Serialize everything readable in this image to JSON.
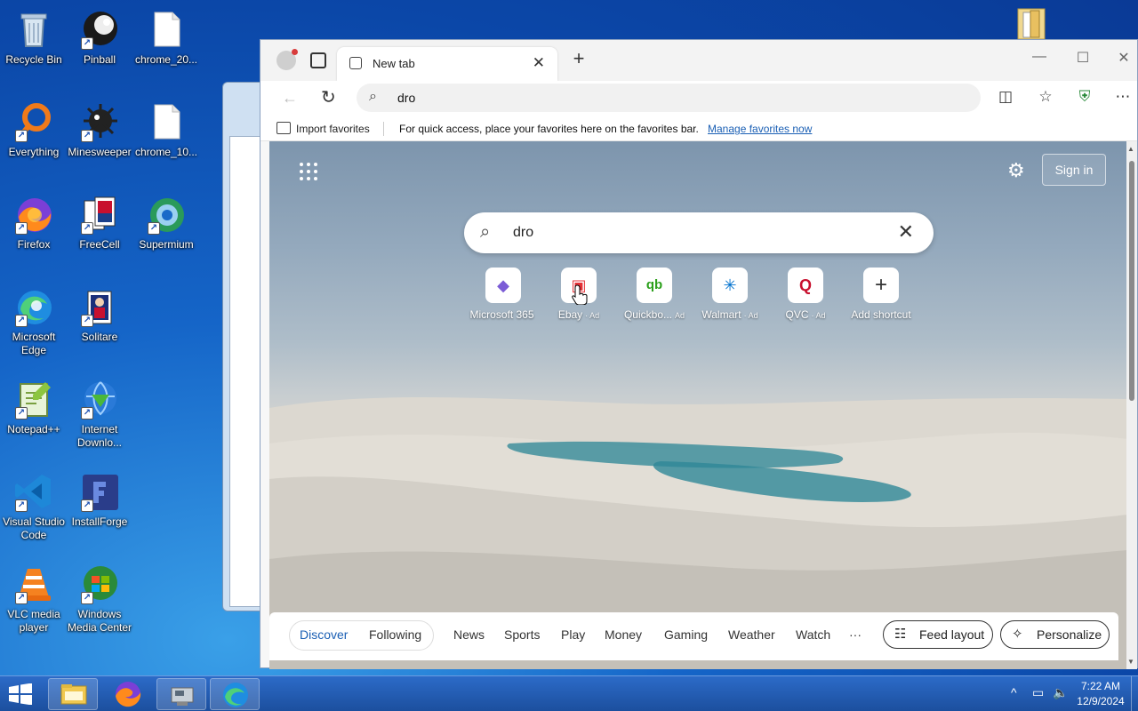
{
  "desktop": {
    "icons": [
      {
        "label": "Recycle Bin"
      },
      {
        "label": "Pinball"
      },
      {
        "label": "chrome_20..."
      },
      {
        "label": "Everything"
      },
      {
        "label": "Minesweeper"
      },
      {
        "label": "chrome_10..."
      },
      {
        "label": "Firefox"
      },
      {
        "label": "FreeCell"
      },
      {
        "label": "Supermium"
      },
      {
        "label": "Microsoft Edge"
      },
      {
        "label": "Solitare"
      },
      {
        "label": "Notepad++"
      },
      {
        "label": "Internet Downlo..."
      },
      {
        "label": "Visual Studio Code"
      },
      {
        "label": "InstallForge"
      },
      {
        "label": "VLC media player"
      },
      {
        "label": "Windows Media Center"
      }
    ],
    "shortcut_glyph": "↗"
  },
  "browser": {
    "tab": {
      "title": "New tab",
      "close": "✕"
    },
    "new_tab": "+",
    "window_controls": {
      "minimize": "—",
      "maximize": "☐",
      "close": "✕"
    },
    "toolbar": {
      "back": "←",
      "refresh": "↻",
      "search_glyph": "⌕",
      "address_value": "dro",
      "split_icon": "◫",
      "favorites_icon": "☆",
      "extension_icon": "⛨",
      "more_icon": "⋯"
    },
    "favbar": {
      "import": "Import favorites",
      "hint": "For quick access, place your favorites here on the favorites bar.",
      "manage": "Manage favorites now"
    }
  },
  "newtab": {
    "settings_icon": "⚙",
    "signin": "Sign in",
    "search": {
      "glyph": "⌕",
      "value": "dro",
      "clear": "✕"
    },
    "shortcuts": [
      {
        "label": "Microsoft 365",
        "ad": "",
        "glyph": "◆",
        "color": "#7b5cd6"
      },
      {
        "label": "Ebay",
        "ad": "· Ad",
        "glyph": "▣",
        "color": "#e53238"
      },
      {
        "label": "Quickbo...",
        "ad": "Ad",
        "glyph": "qb",
        "color": "#2ca01c"
      },
      {
        "label": "Walmart",
        "ad": "· Ad",
        "glyph": "✳",
        "color": "#0071ce"
      },
      {
        "label": "QVC",
        "ad": "· Ad",
        "glyph": "Q",
        "color": "#c8102e"
      },
      {
        "label": "Add shortcut",
        "ad": "",
        "glyph": "+",
        "color": "#333333"
      }
    ],
    "feed": {
      "discover": "Discover",
      "following": "Following",
      "items": [
        "News",
        "Sports",
        "Play",
        "Money",
        "Gaming",
        "Weather",
        "Watch",
        "···"
      ],
      "feed_layout": "Feed layout",
      "feed_layout_icon": "☷",
      "personalize": "Personalize",
      "personalize_icon": "✧"
    }
  },
  "taskbar": {
    "tray": {
      "chevron": "^",
      "network": "▭",
      "volume": "🔈"
    },
    "time": "7:22 AM",
    "date": "12/9/2024"
  }
}
